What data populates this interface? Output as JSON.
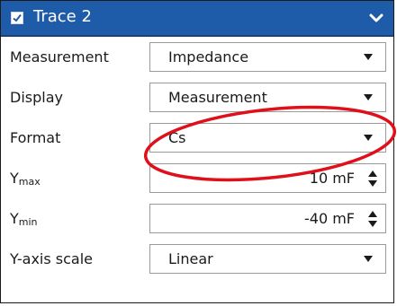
{
  "header": {
    "title": "Trace 2",
    "checked": true,
    "checkbox_icon": "checkbox-checked-icon",
    "collapse_icon": "chevron-down-icon"
  },
  "rows": [
    {
      "label": "Measurement",
      "value": "Impedance",
      "type": "dropdown"
    },
    {
      "label": "Display",
      "value": "Measurement",
      "type": "dropdown"
    },
    {
      "label": "Format",
      "value": "Cs",
      "type": "dropdown"
    },
    {
      "label": "Y",
      "label_sub": "max",
      "value": "10 mF",
      "type": "spinbox"
    },
    {
      "label": "Y",
      "label_sub": "min",
      "value": "-40 mF",
      "type": "spinbox"
    },
    {
      "label": "Y-axis scale",
      "value": "Linear",
      "type": "dropdown"
    }
  ],
  "colors": {
    "header_bg": "#1e5ba8",
    "annotation": "#e0101a"
  },
  "annotation": {
    "shape": "ellipse",
    "target": "Format"
  }
}
